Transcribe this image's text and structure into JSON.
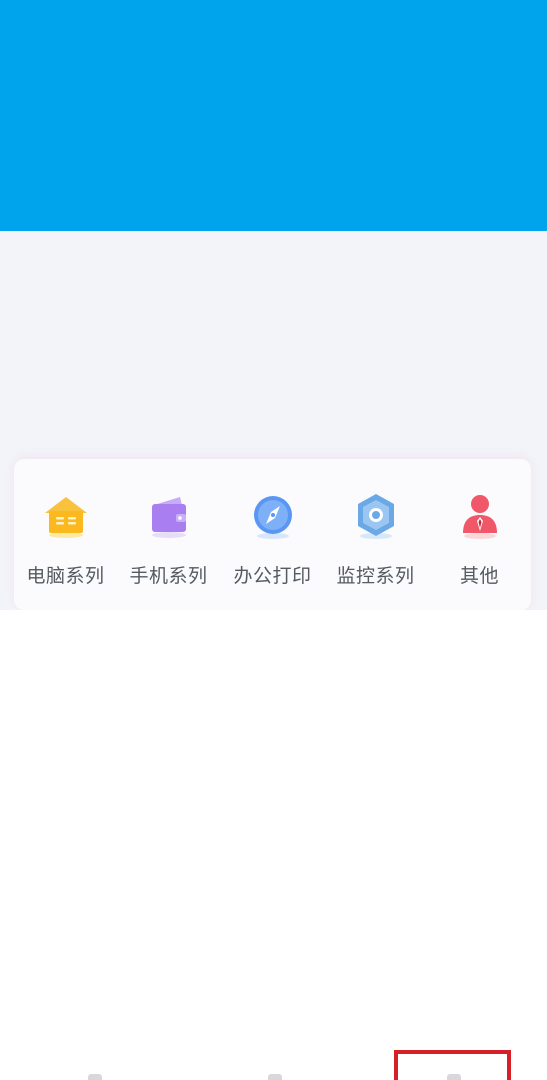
{
  "colors": {
    "banner": "#00a4ec",
    "content_bg": "#f3f4fa"
  },
  "categories": [
    {
      "label": "电脑系列",
      "icon": "house-icon"
    },
    {
      "label": "手机系列",
      "icon": "wallet-icon"
    },
    {
      "label": "办公打印",
      "icon": "compass-icon"
    },
    {
      "label": "监控系列",
      "icon": "hexagon-icon"
    },
    {
      "label": "其他",
      "icon": "person-icon"
    }
  ],
  "bottom_nav": {
    "tabs": [
      {
        "icon": "nav-tab-1-icon"
      },
      {
        "icon": "nav-tab-2-icon"
      },
      {
        "icon": "nav-tab-3-icon"
      }
    ],
    "highlight_color": "#d61f26"
  }
}
